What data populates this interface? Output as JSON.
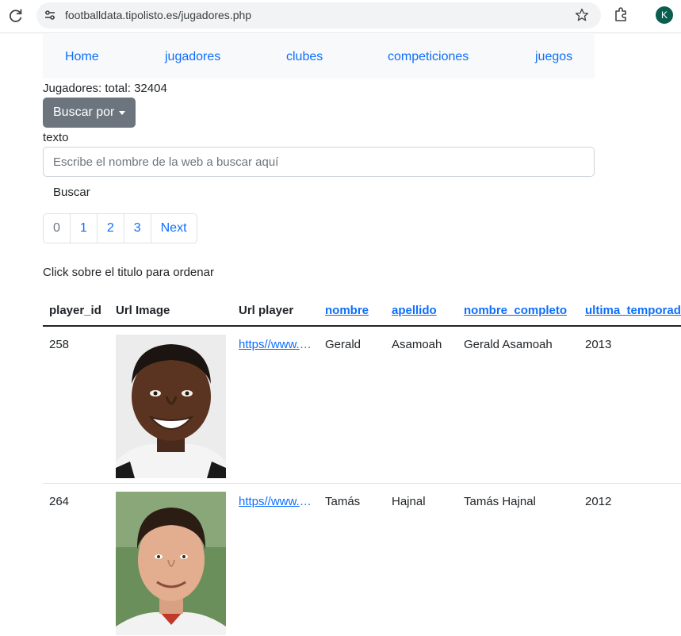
{
  "browser": {
    "url": "footballdata.tipolisto.es/jugadores.php",
    "profile_initial": "K"
  },
  "nav": {
    "items": [
      {
        "label": "Home"
      },
      {
        "label": "jugadores"
      },
      {
        "label": "clubes"
      },
      {
        "label": "competiciones"
      },
      {
        "label": "juegos"
      }
    ]
  },
  "summary": {
    "total_text": "Jugadores: total: 32404"
  },
  "search": {
    "dropdown_label": "Buscar por",
    "field_label": "texto",
    "placeholder": "Escribe el nombre de la web a buscar aquí",
    "value": "",
    "button_label": "Buscar"
  },
  "pagination": {
    "pages": [
      "0",
      "1",
      "2",
      "3"
    ],
    "next_label": "Next"
  },
  "hint": "Click sobre el titulo para ordenar",
  "table": {
    "headers": {
      "player_id": "player_id",
      "url_image": "Url Image",
      "url_player": "Url player",
      "nombre": "nombre",
      "apellido": "apellido",
      "nombre_completo": "nombre_completo",
      "ultima_temporada": "ultima_temporada"
    },
    "rows": [
      {
        "player_id": "258",
        "url_player": "https//www.transfermarkt.co.uk",
        "nombre": "Gerald",
        "apellido": "Asamoah",
        "nombre_completo": "Gerald Asamoah",
        "ultima_temporada": "2013"
      },
      {
        "player_id": "264",
        "url_player": "https//www.transfermarkt.co.uk",
        "nombre": "Tamás",
        "apellido": "Hajnal",
        "nombre_completo": "Tamás Hajnal",
        "ultima_temporada": "2012"
      }
    ]
  },
  "colors": {
    "link": "#0d6efd",
    "button_secondary": "#6c757d",
    "nav_background": "#f8f9fa"
  }
}
